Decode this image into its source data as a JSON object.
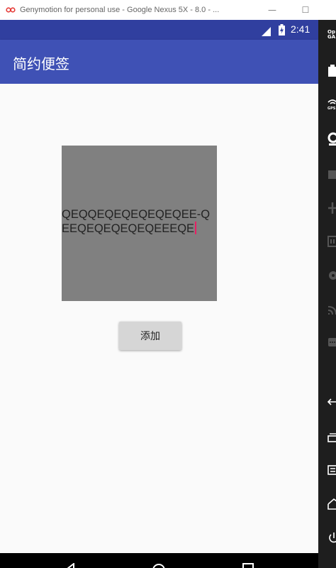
{
  "window": {
    "title": "Genymotion for personal use - Google Nexus 5X - 8.0 - ...",
    "min_glyph": "—",
    "max_glyph": "☐"
  },
  "statusbar": {
    "time": "2:41"
  },
  "appbar": {
    "title": "简约便签"
  },
  "note": {
    "text": "QEQQEQEQEQEQEQEE-QEEQEQEQEQEQEEEQE"
  },
  "add_button": {
    "label": "添加"
  },
  "sidepanel": {
    "logo": "Op GA"
  },
  "colors": {
    "statusbar": "#303f9f",
    "appbar": "#3f51b5",
    "note_box": "#808080",
    "caret": "#e91e63",
    "button": "#d6d6d6"
  }
}
